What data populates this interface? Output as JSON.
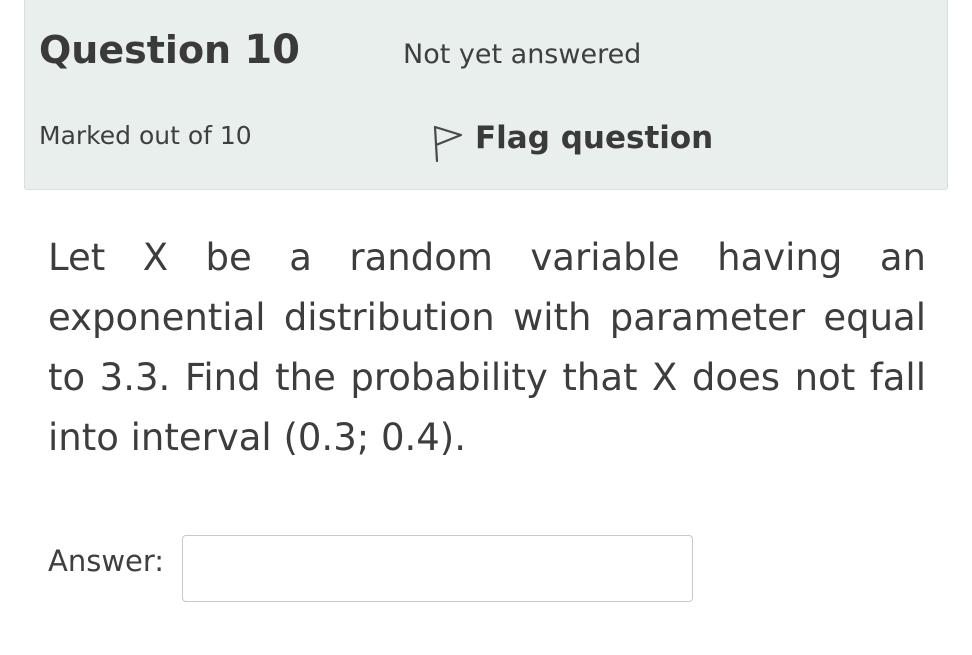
{
  "question": {
    "title_prefix": "Question",
    "number": "10",
    "status": "Not yet answered",
    "marks": "Marked out of 10",
    "flag_label": "Flag question",
    "flag_icon": "flag-outline-icon",
    "text": "Let X be a random variable having an exponential distribution with parameter equal to 3.3. Find the probability that X does not fall into interval (0.3; 0.4)."
  },
  "answer": {
    "label": "Answer:",
    "value": "",
    "placeholder": ""
  },
  "colors": {
    "info_background": "#e8efec",
    "text": "#3d3d3d"
  }
}
